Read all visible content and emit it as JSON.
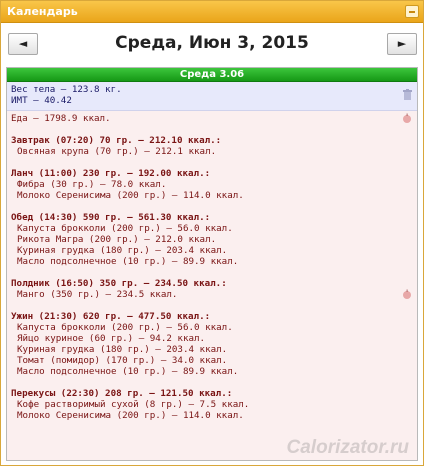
{
  "window": {
    "title": "Календарь"
  },
  "nav": {
    "prev_label": "◄",
    "next_label": "►",
    "date_heading": "Среда, Июн 3, 2015"
  },
  "day": {
    "header": "Среда 3.06",
    "body": {
      "weight": "Вес тела — 123.8 кг.",
      "bmi": "ИМТ — 40.42"
    },
    "food_total": "Еда — 1798.9 ккал.",
    "meals": [
      {
        "title": "Завтрак (07:20) 70 гр. — 212.10 ккал.:",
        "items": [
          "Овсяная крупа (70 гр.) — 212.1 ккал."
        ]
      },
      {
        "title": "Ланч (11:00) 230 гр. — 192.00 ккал.:",
        "items": [
          "Фибра (30 гр.) — 78.0 ккал.",
          "Молоко Серенисима (200 гр.) — 114.0 ккал."
        ]
      },
      {
        "title": "Обед (14:30) 590 гр. — 561.30 ккал.:",
        "items": [
          "Капуста брокколи (200 гр.) — 56.0 ккал.",
          "Рикота Магра (200 гр.) — 212.0 ккал.",
          "Куриная грудка (180 гр.) — 203.4 ккал.",
          "Масло подсолнечное (10 гр.) — 89.9 ккал."
        ]
      },
      {
        "title": "Полдник (16:50) 350 гр. — 234.50 ккал.:",
        "items": [
          "Манго (350 гр.) — 234.5 ккал."
        ]
      },
      {
        "title": "Ужин (21:30) 620 гр. — 477.50 ккал.:",
        "items": [
          "Капуста брокколи (200 гр.) — 56.0 ккал.",
          "Яйцо куриное (60 гр.) — 94.2 ккал.",
          "Куриная грудка (180 гр.) — 203.4 ккал.",
          "Томат (помидор) (170 гр.) — 34.0 ккал.",
          "Масло подсолнечное (10 гр.) — 89.9 ккал."
        ]
      },
      {
        "title": "Перекусы (22:30) 208 гр. — 121.50 ккал.:",
        "items": [
          "Кофе растворимый сухой (8 гр.) — 7.5 ккал.",
          "Молоко Серенисима (200 гр.) — 114.0 ккал."
        ]
      }
    ]
  },
  "watermark": "Calorizator.ru",
  "icons": {
    "minimize": "minimize-icon",
    "trash": "trash-icon",
    "apple": "apple-icon"
  },
  "colors": {
    "title_bar": "#eaa51a",
    "day_header": "#169816",
    "stats_bg": "#e7e9fb",
    "food_bg": "#fbefef",
    "food_text": "#7a1414",
    "stats_text": "#1a1a66"
  }
}
